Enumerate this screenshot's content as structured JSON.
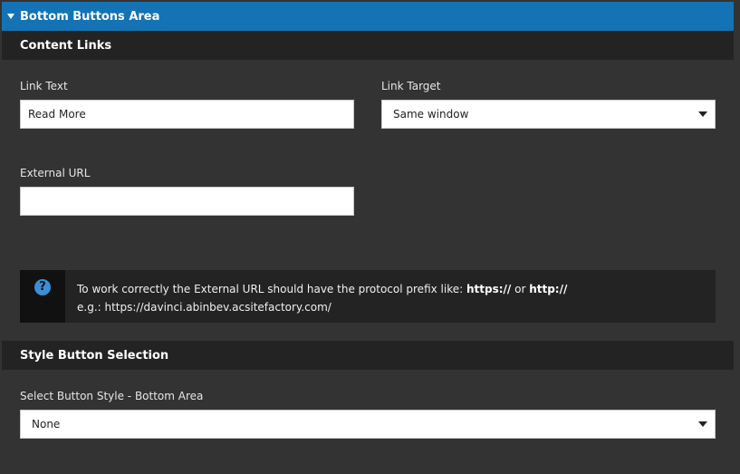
{
  "panel": {
    "title": "Bottom Buttons Area"
  },
  "content_links": {
    "heading": "Content Links",
    "link_text": {
      "label": "Link Text",
      "value": "Read More"
    },
    "link_target": {
      "label": "Link Target",
      "selected": "Same window"
    },
    "external_url": {
      "label": "External URL",
      "value": ""
    },
    "info": {
      "line1_prefix": "To work correctly the External URL should have the protocol prefix like: ",
      "proto_https": "https://",
      "or_word": " or ",
      "proto_http": "http://",
      "line2": "e.g.: https://davinci.abinbev.acsitefactory.com/"
    }
  },
  "style_button": {
    "heading": "Style Button Selection",
    "select_label": "Select Button Style - Bottom Area",
    "selected": "None"
  },
  "colors": {
    "panel_header_bg": "#1373b5",
    "section_header_bg": "#232323",
    "body_bg": "#333333",
    "info_icon": "#3a8fd6"
  }
}
